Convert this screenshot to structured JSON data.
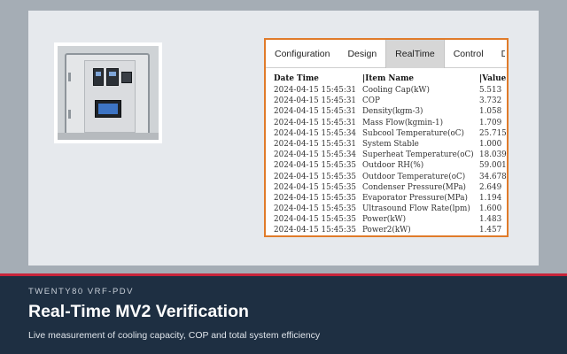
{
  "app": {
    "tabs": [
      {
        "label": "Configuration",
        "active": false
      },
      {
        "label": "Design",
        "active": false
      },
      {
        "label": "RealTime",
        "active": true
      },
      {
        "label": "Control",
        "active": false
      },
      {
        "label": "D",
        "active": false
      }
    ]
  },
  "table": {
    "headers": [
      "Date Time",
      "|Item Name",
      "|Value"
    ],
    "rows": [
      [
        "2024-04-15 15:45:31",
        "Cooling Cap(kW)",
        "5.513"
      ],
      [
        "2024-04-15 15:45:31",
        "COP",
        "3.732"
      ],
      [
        "2024-04-15 15:45:31",
        "Density(kgm-3)",
        "1.058"
      ],
      [
        "2024-04-15 15:45:31",
        "Mass Flow(kgmin-1)",
        "1.709"
      ],
      [
        "2024-04-15 15:45:34",
        "Subcool Temperature(oC)",
        "25.715"
      ],
      [
        "2024-04-15 15:45:31",
        "System Stable",
        "1.000"
      ],
      [
        "2024-04-15 15:45:34",
        "Superheat Temperature(oC)",
        "18.039"
      ],
      [
        "2024-04-15 15:45:35",
        "Outdoor RH(%)",
        "59.001"
      ],
      [
        "2024-04-15 15:45:35",
        "Outdoor Temperature(oC)",
        "34.678"
      ],
      [
        "2024-04-15 15:45:35",
        "Condenser Pressure(MPa)",
        "2.649"
      ],
      [
        "2024-04-15 15:45:35",
        "Evaporator Pressure(MPa)",
        "1.194"
      ],
      [
        "2024-04-15 15:45:35",
        "Ultrasound Flow Rate(lpm)",
        "1.600"
      ],
      [
        "2024-04-15 15:45:35",
        "Power(kW)",
        "1.483"
      ],
      [
        "2024-04-15 15:45:35",
        "Power2(kW)",
        "1.457"
      ]
    ]
  },
  "banner": {
    "eyebrow": "TWENTY80 VRF-PDV",
    "title": "Real-Time MV2 Verification",
    "subtitle": "Live measurement of cooling capacity, COP and total system efficiency"
  },
  "colors": {
    "frame_accent": "#e07b2a",
    "banner_bg": "#1e2f42",
    "banner_stripe": "#c8243a",
    "row_alt": "#e6f0dc",
    "active_tab": "#d6d6d6"
  },
  "icons": {
    "photo": "control-cabinet-photo"
  }
}
